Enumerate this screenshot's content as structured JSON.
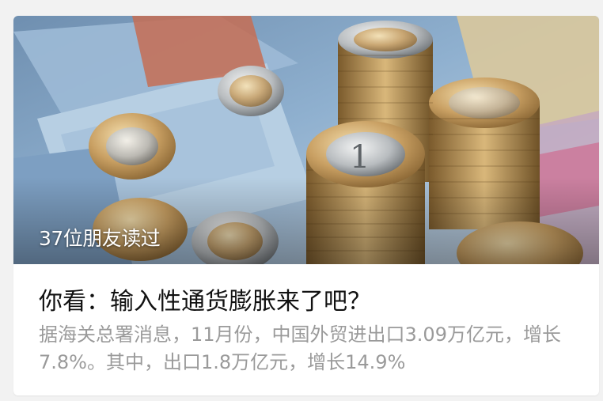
{
  "article": {
    "read_count": "37位朋友读过",
    "title": "你看：输入性通货膨胀来了吧？",
    "summary": "据海关总署消息，11月份，中国外贸进出口3.09万亿元，增长7.8%。其中，出口1.8万亿元，增长14.9%"
  },
  "cover": {
    "subject": "euro banknotes and stacked euro coins"
  }
}
